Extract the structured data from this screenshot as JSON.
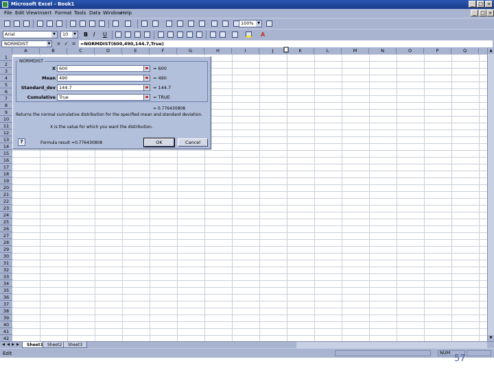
{
  "window": {
    "title": "Microsoft Excel - Book1"
  },
  "menu": [
    "File",
    "Edit",
    "View",
    "Insert",
    "Format",
    "Tools",
    "Data",
    "Window",
    "Help"
  ],
  "toolbar": {
    "zoom": "100%",
    "font_name": "Arial",
    "font_size": "10"
  },
  "formula_bar": {
    "name_box": "NORMDIST",
    "formula": "=NORMDIST(600,490,144.7,True)",
    "cancel": "×",
    "enter": "✓",
    "equals": "="
  },
  "columns": [
    "A",
    "B",
    "C",
    "D",
    "E",
    "F",
    "G",
    "H",
    "I",
    "J",
    "K",
    "L",
    "M",
    "N",
    "O",
    "P",
    "Q"
  ],
  "rows": [
    "1",
    "2",
    "3",
    "4",
    "5",
    "6",
    "7",
    "8",
    "9",
    "10",
    "11",
    "12",
    "13",
    "14",
    "15",
    "16",
    "17",
    "18",
    "19",
    "20",
    "21",
    "22",
    "23",
    "24",
    "25",
    "26",
    "27",
    "28",
    "29",
    "30",
    "31",
    "32",
    "33",
    "34",
    "35",
    "36",
    "37",
    "38",
    "39",
    "40",
    "41",
    "42"
  ],
  "dialog": {
    "title": "NORMDIST",
    "args": [
      {
        "label": "X",
        "value": "600",
        "result": "= 600"
      },
      {
        "label": "Mean",
        "value": "490",
        "result": "= 490"
      },
      {
        "label": "Standard_dev",
        "value": "144.7",
        "result": "= 144.7"
      },
      {
        "label": "Cumulative",
        "value": "True",
        "result": "= TRUE"
      }
    ],
    "result": "= 0.776430808",
    "description": "Returns the normal cumulative distribution for the specified mean and standard deviation.",
    "arg_help": "X  is the value for which you want the distribution.",
    "formula_result": "Formula result =0.776430808",
    "ok": "OK",
    "cancel": "Cancel",
    "help": "?"
  },
  "sheets": [
    "Sheet1",
    "Sheet2",
    "Sheet3"
  ],
  "status": {
    "mode": "Edit",
    "num": "NUM"
  },
  "page_number": "57"
}
